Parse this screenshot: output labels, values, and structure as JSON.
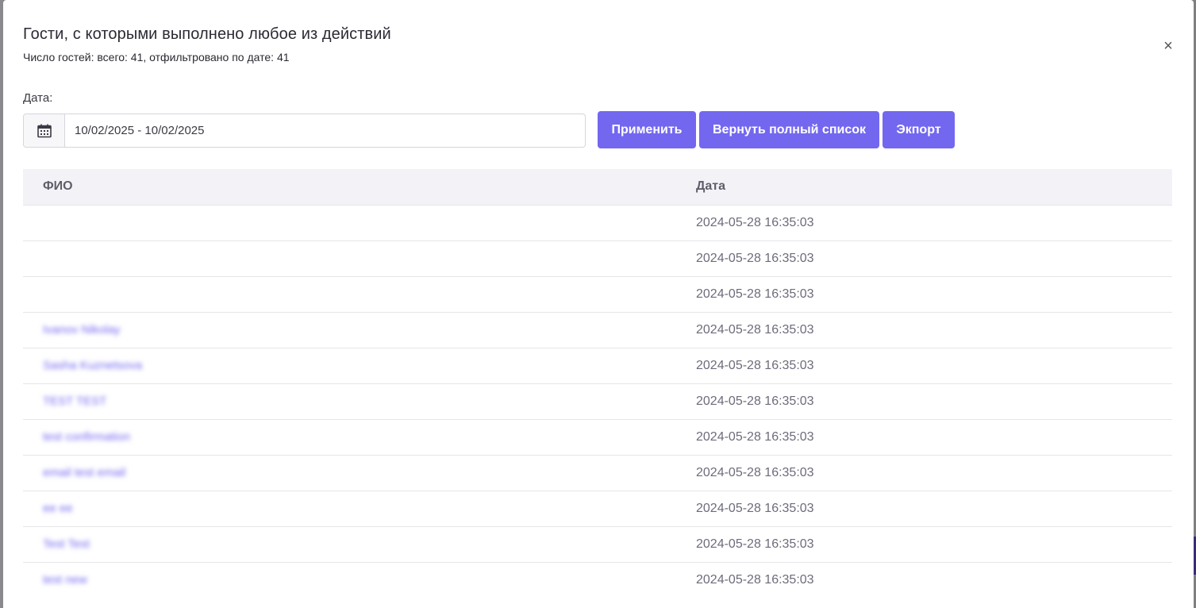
{
  "modal": {
    "title": "Гости, с которыми выполнено любое из действий",
    "subtitle": "Число гостей: всего: 41, отфильтровано по дате: 41",
    "close_label": "×"
  },
  "filter": {
    "date_label": "Дата:",
    "date_range": "10/02/2025 - 10/02/2025",
    "calendar_icon": "calendar-icon",
    "apply_label": "Применить",
    "reset_label": "Вернуть полный список",
    "export_label": "Экпорт"
  },
  "table": {
    "columns": [
      "ФИО",
      "Дата"
    ],
    "rows": [
      {
        "name": "",
        "date": "2024-05-28 16:35:03"
      },
      {
        "name": "",
        "date": "2024-05-28 16:35:03"
      },
      {
        "name": "",
        "date": "2024-05-28 16:35:03"
      },
      {
        "name": "Ivanov Nikolay",
        "date": "2024-05-28 16:35:03"
      },
      {
        "name": "Sasha Kuznetsova",
        "date": "2024-05-28 16:35:03"
      },
      {
        "name": "TEST TEST",
        "date": "2024-05-28 16:35:03"
      },
      {
        "name": "test confirmation",
        "date": "2024-05-28 16:35:03"
      },
      {
        "name": "email test email",
        "date": "2024-05-28 16:35:03"
      },
      {
        "name": "ee ee",
        "date": "2024-05-28 16:35:03"
      },
      {
        "name": "Test Test",
        "date": "2024-05-28 16:35:03"
      },
      {
        "name": "test new",
        "date": "2024-05-28 16:35:03"
      }
    ]
  },
  "colors": {
    "accent": "#7367f0",
    "header_bg": "#f3f2f7"
  }
}
